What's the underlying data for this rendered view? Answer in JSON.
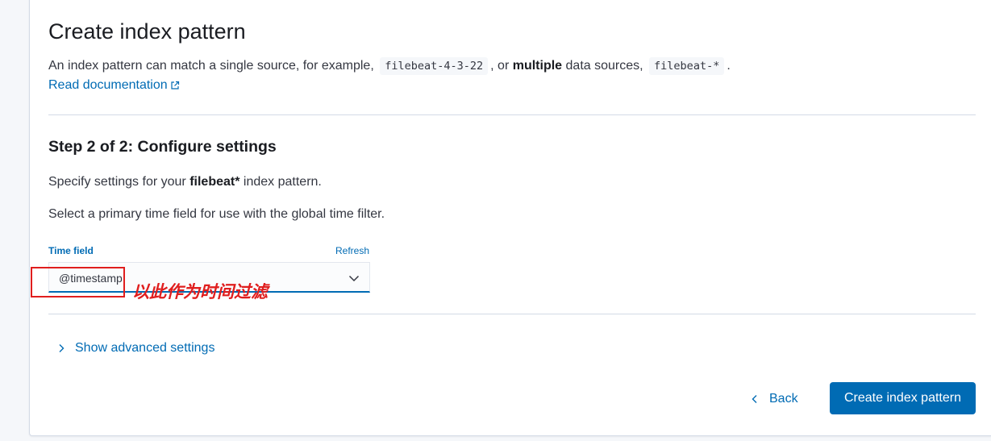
{
  "header": {
    "title": "Create index pattern",
    "description": {
      "part1": "An index pattern can match a single source, for example,",
      "code1": "filebeat-4-3-22",
      "part2": ", or",
      "bold": "multiple",
      "part3": "data sources,",
      "code2": "filebeat-*",
      "part4": "."
    },
    "doc_link": "Read documentation",
    "doc_link_icon": "external-link-icon"
  },
  "step": {
    "title": "Step 2 of 2: Configure settings",
    "specify_prefix": "Specify settings for your",
    "pattern_name": "filebeat*",
    "specify_suffix": "index pattern.",
    "time_filter_text": "Select a primary time field for use with the global time filter."
  },
  "time_field": {
    "label": "Time field",
    "refresh": "Refresh",
    "value": "@timestamp",
    "dropdown_icon": "chevron-down-icon"
  },
  "annotation": {
    "text": "以此作为时间过滤",
    "color": "#e01e1e"
  },
  "advanced": {
    "label": "Show advanced settings",
    "icon": "chevron-right-icon"
  },
  "actions": {
    "back_label": "Back",
    "back_icon": "chevron-left-icon",
    "create_label": "Create index pattern"
  },
  "colors": {
    "accent": "#006bb4",
    "text": "#343741",
    "border": "#d3dae6"
  }
}
